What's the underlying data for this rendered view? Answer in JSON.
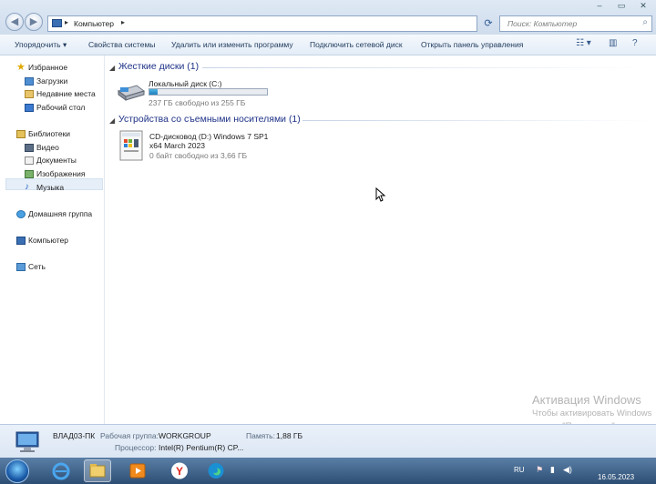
{
  "address_bar": {
    "path_label": "Компьютер",
    "search_placeholder": "Поиск: Компьютер",
    "back_label": "◀",
    "forward_label": "▶"
  },
  "toolbar": {
    "organize": "Упорядочить",
    "system_properties": "Свойства системы",
    "uninstall": "Удалить или изменить программу",
    "map_drive": "Подключить сетевой диск",
    "control_panel": "Открыть панель управления"
  },
  "nav": {
    "favorites": "Избранное",
    "downloads": "Загрузки",
    "recent": "Недавние места",
    "desktop": "Рабочий стол",
    "libraries": "Библиотеки",
    "video": "Видео",
    "documents": "Документы",
    "images": "Изображения",
    "music": "Музыка",
    "homegroup": "Домашняя группа",
    "computer": "Компьютер",
    "network": "Сеть"
  },
  "content": {
    "hard_drives_header": "Жесткие диски (1)",
    "drive_c": {
      "name": "Локальный диск (C:)",
      "free": "237 ГБ свободно из 255 ГБ",
      "used_fraction": 0.07
    },
    "removable_header": "Устройства со съемными носителями (1)",
    "drive_d": {
      "name_line1": "CD-дисковод (D:) Windows 7 SP1",
      "name_line2": "x64 March 2023",
      "free": "0 байт свободно из 3,66 ГБ"
    }
  },
  "details": {
    "computer_name": "ВЛАД03-ПК",
    "workgroup_label": "Рабочая группа:",
    "workgroup_value": "WORKGROUP",
    "memory_label": "Память:",
    "memory_value": "1,88 ГБ",
    "cpu_label": "Процессор:",
    "cpu_value": "Intel(R) Pentium(R) CP..."
  },
  "watermark": {
    "line1": "Активация Windows",
    "line2": "Чтобы активировать Windows",
    "line3": "раздел \"Параметры\"."
  },
  "taskbar": {
    "lang": "RU",
    "date": "16.05.2023"
  },
  "colors": {
    "accent": "#1e3287",
    "taskbar": "#2d4e74"
  }
}
